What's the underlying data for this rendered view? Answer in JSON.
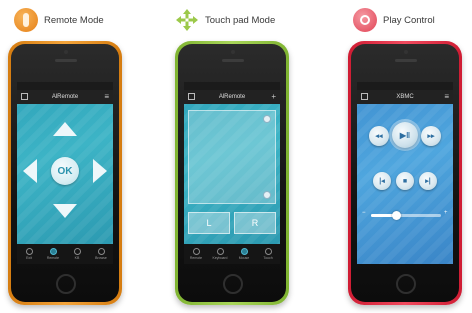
{
  "panels": [
    {
      "heading": "Remote Mode",
      "app_title": "AlRemote",
      "center_button": "OK",
      "tabs": [
        "Exit",
        "Remote",
        "KB",
        "Browse"
      ],
      "active_tab": 1,
      "phone_color": "#e9931f",
      "heading_icon_color": "#f0962a",
      "icon": "remote-control-icon"
    },
    {
      "heading": "Touch pad Mode",
      "app_title": "AlRemote",
      "left_click": "L",
      "right_click": "R",
      "tabs": [
        "Remote",
        "Keyboard",
        "Mouse",
        "Touch"
      ],
      "active_tab": 2,
      "phone_color": "#8fc63f",
      "heading_icon_color": "#9cc94a",
      "icon": "move-arrows-icon"
    },
    {
      "heading": "Play Control",
      "app_title": "XBMC",
      "volume_level": 0.35,
      "phone_color": "#e3243d",
      "heading_icon_color": "#e8505f",
      "icon": "music-disc-icon"
    }
  ]
}
